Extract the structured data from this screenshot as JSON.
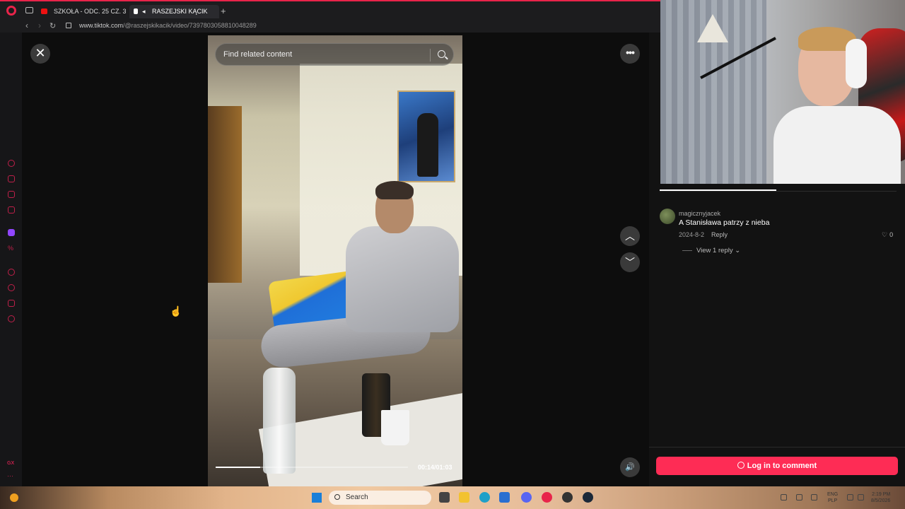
{
  "browser": {
    "tabs": [
      {
        "label": "SZKOŁA - ODC. 25 CZ. 3 -"
      },
      {
        "label": "RASZEJSKI KĄCIK"
      }
    ],
    "new_tab": "+",
    "url_host": "www.tiktok.com",
    "url_path": "/@raszejskikacik/video/7397803058810048289"
  },
  "player": {
    "close_label": "✕",
    "search_placeholder": "Find related content",
    "more_label": "•••",
    "prev_label": "︿",
    "next_label": "﹀",
    "volume_label": "🔊",
    "time": "00:14/01:03",
    "progress": 0.23
  },
  "comments": {
    "items": [
      {
        "user": "magicznyjacek",
        "text": "A Stanisława patrzy z nieba",
        "date": "2024-8-2",
        "reply_label": "Reply",
        "likes": "0",
        "view_replies": "View 1 reply"
      }
    ],
    "login_label": "Log in to comment"
  },
  "taskbar": {
    "search_label": "Search",
    "lang_top": "ENG",
    "lang_bottom": "PLP",
    "time": "2:19 PM",
    "date": "8/5/2026"
  },
  "colors": {
    "accent": "#fe2c55",
    "opera": "#e8244a"
  }
}
